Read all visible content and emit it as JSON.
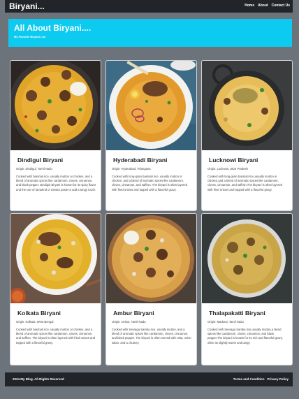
{
  "navbar": {
    "brand": "Biryani...",
    "links": [
      "Home",
      "About",
      "Contact Us"
    ]
  },
  "hero": {
    "title": "All About Biryani....",
    "subtitle": "My Favorite Biryani List"
  },
  "cards": [
    {
      "title": "Dindigul Biryani",
      "origin": "Origin: Dindigul, Tamil Nadu",
      "description": "Cooked with basmati rice, usually mutton or chicken, and a blend of aromatic spices like cardamom, cloves, cinnamon, and black pepper. Dindigul Biryani is known for its spicy flavor and the use of tamarind or tomato paste to add a tangy touch."
    },
    {
      "title": "Hyderabadi Biryani",
      "origin": "Origin: Hyderabad, Telangana",
      "description": "Cooked with long-grain basmati rice, usually mutton or chicken, and a blend of aromatic spices like cardamom, cloves, cinnamon, and saffron. The biryani is often layered with fried onions and topped with a flavorful gravy."
    },
    {
      "title": "Lucknowi Biryani",
      "origin": "Origin: Lucknow, Uttar Pradesh",
      "description": "Cooked with long-grain basmati rice,usually mutton or chicken,and a blend of aromatic spices like cardamom, cloves, cinnamon, and saffron.The biryani is often layered with fried onions and topped with a flavorful gravy."
    },
    {
      "title": "Kolkata Biryani",
      "origin": "Origin: Kolkata, West Bengal",
      "description": "Cooked with basmati rice, usually mutton or chicken, and a blend of aromatic spices like cardamom, cloves, cinnamon, and saffron. The biryani is often layered with fried onions and topped with a flavorful gravy."
    },
    {
      "title": "Ambur Biryani",
      "origin": "Origin: Ambur, Tamil Nadu",
      "description": "Cooked with Seeraga Samba rice, usually mutton, and a blend of aromatic spices like cardamom, cloves, cinnamon, and black pepper. The biryani is often served with raita, onion salan, and a chutney."
    },
    {
      "title": "Thalapakatti Biryani",
      "origin": "Origin: Madurai, Tamil Nadu",
      "description": "Cooked with Seeraga Samba rice,usually mutton,a blend spices like cardamom, cloves, cinnamon, and black pepper.The biryani is known for its rich and flavorful gravy, often as slightly sweet and tangy."
    }
  ],
  "footer": {
    "copyright": "2024 My Blog. All Rights Reserved",
    "links": [
      "Terms and Condition",
      "Privacy Policy"
    ]
  },
  "colors": {
    "navbar": "#212529",
    "hero": "#0dcaf0",
    "page_background": "#6c737b",
    "rice": "#e0a528",
    "meat": "#6b4226"
  }
}
